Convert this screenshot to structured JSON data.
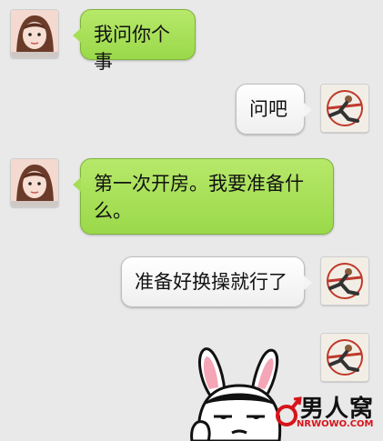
{
  "messages": [
    {
      "side": "left",
      "text": "我问你个事"
    },
    {
      "side": "right",
      "text": "问吧"
    },
    {
      "side": "left",
      "text": "第一次开房。我要准备什么。"
    },
    {
      "side": "right",
      "text": "准备好换操就行了"
    }
  ],
  "watermark": {
    "title": "男人窝",
    "url": "NRWOWO.COM"
  },
  "icons": {
    "left_avatar": "girl-avatar-icon",
    "right_avatar": "kungfu-kick-avatar-icon",
    "sticker": "bunny-ears-meme-sticker",
    "watermark_logo": "male-symbol-logo"
  },
  "colors": {
    "green_bubble": "#a6de55",
    "white_bubble": "#f4f4f4",
    "background": "#e9e9e9",
    "watermark_red": "#d7141b"
  }
}
